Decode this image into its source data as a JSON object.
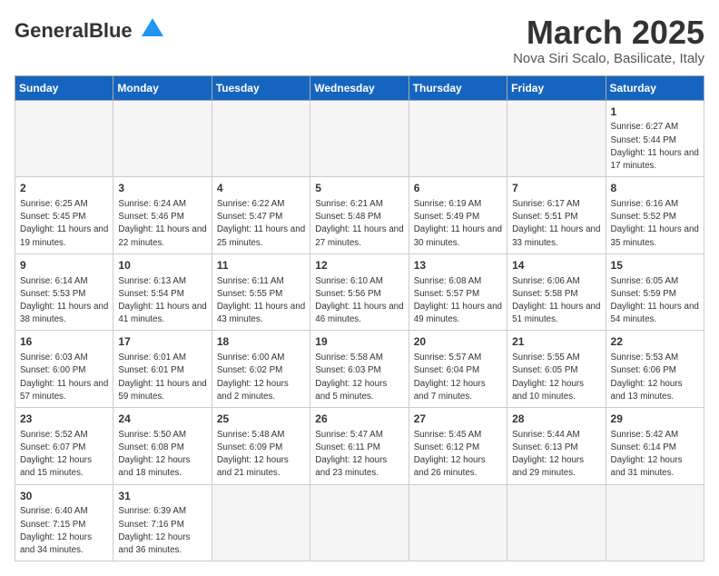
{
  "header": {
    "logo_general": "General",
    "logo_blue": "Blue",
    "month_title": "March 2025",
    "subtitle": "Nova Siri Scalo, Basilicate, Italy"
  },
  "weekdays": [
    "Sunday",
    "Monday",
    "Tuesday",
    "Wednesday",
    "Thursday",
    "Friday",
    "Saturday"
  ],
  "weeks": [
    [
      {
        "day": "",
        "info": ""
      },
      {
        "day": "",
        "info": ""
      },
      {
        "day": "",
        "info": ""
      },
      {
        "day": "",
        "info": ""
      },
      {
        "day": "",
        "info": ""
      },
      {
        "day": "",
        "info": ""
      },
      {
        "day": "1",
        "info": "Sunrise: 6:27 AM\nSunset: 5:44 PM\nDaylight: 11 hours and 17 minutes."
      }
    ],
    [
      {
        "day": "2",
        "info": "Sunrise: 6:25 AM\nSunset: 5:45 PM\nDaylight: 11 hours and 19 minutes."
      },
      {
        "day": "3",
        "info": "Sunrise: 6:24 AM\nSunset: 5:46 PM\nDaylight: 11 hours and 22 minutes."
      },
      {
        "day": "4",
        "info": "Sunrise: 6:22 AM\nSunset: 5:47 PM\nDaylight: 11 hours and 25 minutes."
      },
      {
        "day": "5",
        "info": "Sunrise: 6:21 AM\nSunset: 5:48 PM\nDaylight: 11 hours and 27 minutes."
      },
      {
        "day": "6",
        "info": "Sunrise: 6:19 AM\nSunset: 5:49 PM\nDaylight: 11 hours and 30 minutes."
      },
      {
        "day": "7",
        "info": "Sunrise: 6:17 AM\nSunset: 5:51 PM\nDaylight: 11 hours and 33 minutes."
      },
      {
        "day": "8",
        "info": "Sunrise: 6:16 AM\nSunset: 5:52 PM\nDaylight: 11 hours and 35 minutes."
      }
    ],
    [
      {
        "day": "9",
        "info": "Sunrise: 6:14 AM\nSunset: 5:53 PM\nDaylight: 11 hours and 38 minutes."
      },
      {
        "day": "10",
        "info": "Sunrise: 6:13 AM\nSunset: 5:54 PM\nDaylight: 11 hours and 41 minutes."
      },
      {
        "day": "11",
        "info": "Sunrise: 6:11 AM\nSunset: 5:55 PM\nDaylight: 11 hours and 43 minutes."
      },
      {
        "day": "12",
        "info": "Sunrise: 6:10 AM\nSunset: 5:56 PM\nDaylight: 11 hours and 46 minutes."
      },
      {
        "day": "13",
        "info": "Sunrise: 6:08 AM\nSunset: 5:57 PM\nDaylight: 11 hours and 49 minutes."
      },
      {
        "day": "14",
        "info": "Sunrise: 6:06 AM\nSunset: 5:58 PM\nDaylight: 11 hours and 51 minutes."
      },
      {
        "day": "15",
        "info": "Sunrise: 6:05 AM\nSunset: 5:59 PM\nDaylight: 11 hours and 54 minutes."
      }
    ],
    [
      {
        "day": "16",
        "info": "Sunrise: 6:03 AM\nSunset: 6:00 PM\nDaylight: 11 hours and 57 minutes."
      },
      {
        "day": "17",
        "info": "Sunrise: 6:01 AM\nSunset: 6:01 PM\nDaylight: 11 hours and 59 minutes."
      },
      {
        "day": "18",
        "info": "Sunrise: 6:00 AM\nSunset: 6:02 PM\nDaylight: 12 hours and 2 minutes."
      },
      {
        "day": "19",
        "info": "Sunrise: 5:58 AM\nSunset: 6:03 PM\nDaylight: 12 hours and 5 minutes."
      },
      {
        "day": "20",
        "info": "Sunrise: 5:57 AM\nSunset: 6:04 PM\nDaylight: 12 hours and 7 minutes."
      },
      {
        "day": "21",
        "info": "Sunrise: 5:55 AM\nSunset: 6:05 PM\nDaylight: 12 hours and 10 minutes."
      },
      {
        "day": "22",
        "info": "Sunrise: 5:53 AM\nSunset: 6:06 PM\nDaylight: 12 hours and 13 minutes."
      }
    ],
    [
      {
        "day": "23",
        "info": "Sunrise: 5:52 AM\nSunset: 6:07 PM\nDaylight: 12 hours and 15 minutes."
      },
      {
        "day": "24",
        "info": "Sunrise: 5:50 AM\nSunset: 6:08 PM\nDaylight: 12 hours and 18 minutes."
      },
      {
        "day": "25",
        "info": "Sunrise: 5:48 AM\nSunset: 6:09 PM\nDaylight: 12 hours and 21 minutes."
      },
      {
        "day": "26",
        "info": "Sunrise: 5:47 AM\nSunset: 6:11 PM\nDaylight: 12 hours and 23 minutes."
      },
      {
        "day": "27",
        "info": "Sunrise: 5:45 AM\nSunset: 6:12 PM\nDaylight: 12 hours and 26 minutes."
      },
      {
        "day": "28",
        "info": "Sunrise: 5:44 AM\nSunset: 6:13 PM\nDaylight: 12 hours and 29 minutes."
      },
      {
        "day": "29",
        "info": "Sunrise: 5:42 AM\nSunset: 6:14 PM\nDaylight: 12 hours and 31 minutes."
      }
    ],
    [
      {
        "day": "30",
        "info": "Sunrise: 6:40 AM\nSunset: 7:15 PM\nDaylight: 12 hours and 34 minutes."
      },
      {
        "day": "31",
        "info": "Sunrise: 6:39 AM\nSunset: 7:16 PM\nDaylight: 12 hours and 36 minutes."
      },
      {
        "day": "",
        "info": ""
      },
      {
        "day": "",
        "info": ""
      },
      {
        "day": "",
        "info": ""
      },
      {
        "day": "",
        "info": ""
      },
      {
        "day": "",
        "info": ""
      }
    ]
  ]
}
